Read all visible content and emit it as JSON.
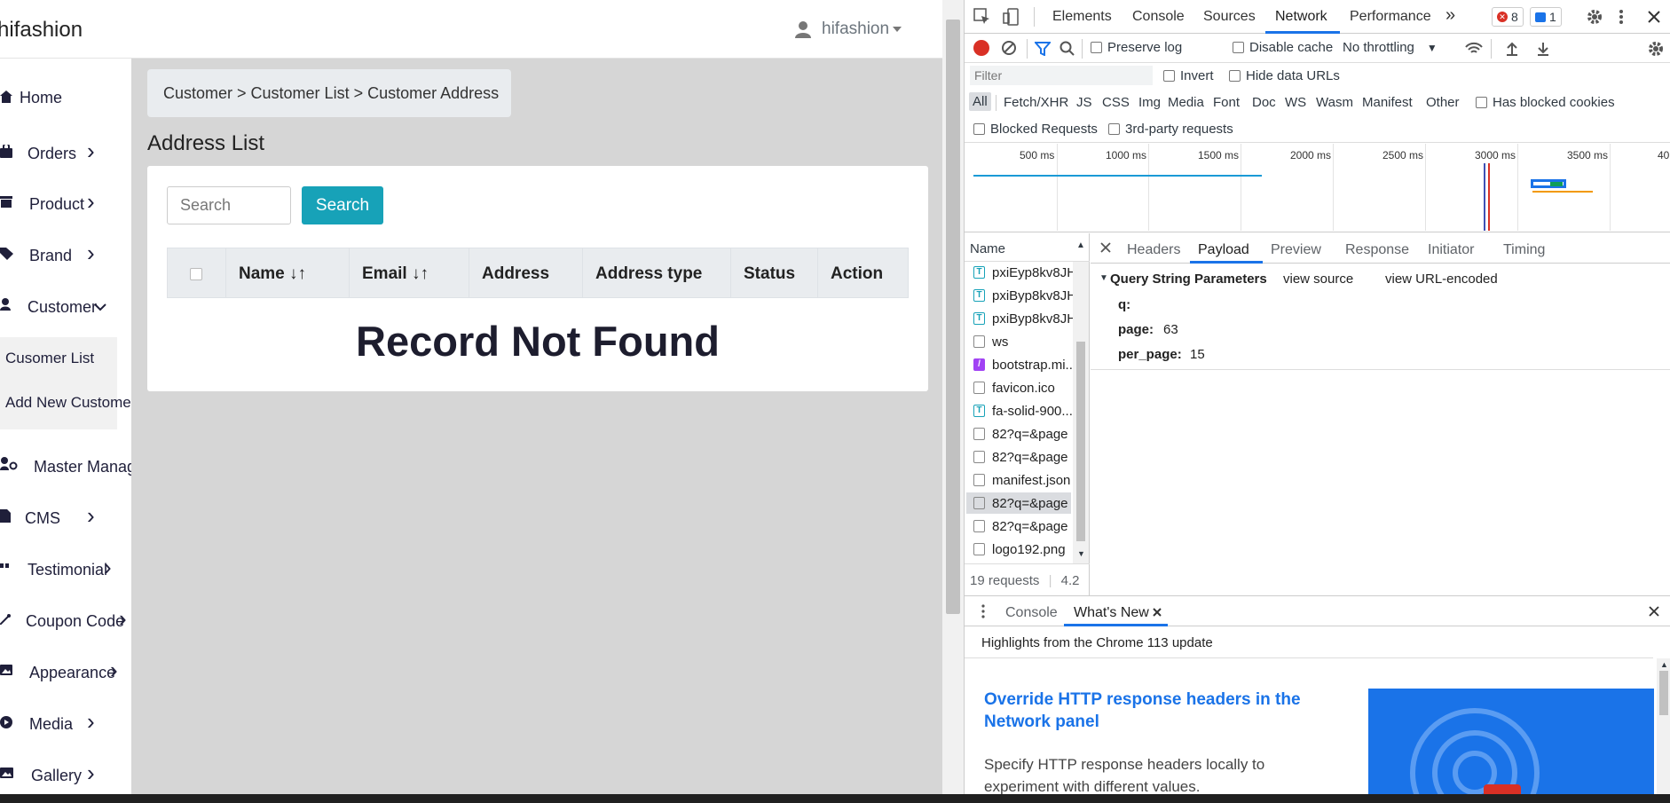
{
  "app": {
    "brand": "hifashion",
    "user": "hifashion"
  },
  "sidebar": {
    "items": [
      {
        "label": "Home",
        "chevron": ""
      },
      {
        "label": "Orders",
        "chevron": "›"
      },
      {
        "label": "Product",
        "chevron": "›"
      },
      {
        "label": "Brand",
        "chevron": "›"
      },
      {
        "label": "Customer",
        "chevron": "⌄"
      },
      {
        "label": "Master Manage",
        "chevron": ""
      },
      {
        "label": "CMS",
        "chevron": "›"
      },
      {
        "label": "Testimonial",
        "chevron": "›"
      },
      {
        "label": "Coupon Code",
        "chevron": "›"
      },
      {
        "label": "Appearance",
        "chevron": "›"
      },
      {
        "label": "Media",
        "chevron": "›"
      },
      {
        "label": "Gallery",
        "chevron": "›"
      }
    ],
    "customer_sub": [
      "Cusomer List",
      "Add New Customer"
    ]
  },
  "content": {
    "breadcrumb": "Customer > Customer List > Customer Address",
    "title": "Address List",
    "search_placeholder": "Search",
    "search_button": "Search",
    "columns": [
      "",
      "Name ↓↑",
      "Email ↓↑",
      "Address",
      "Address type",
      "Status",
      "Action"
    ],
    "empty_message": "Record Not Found"
  },
  "devtools": {
    "tabs": [
      "Elements",
      "Console",
      "Sources",
      "Network",
      "Performance",
      "»"
    ],
    "active_tab": "Network",
    "error_count": "8",
    "message_count": "1",
    "toolbar": {
      "preserve_log": "Preserve log",
      "disable_cache": "Disable cache",
      "throttling": "No throttling"
    },
    "filter": {
      "placeholder": "Filter",
      "invert": "Invert",
      "hide_data_urls": "Hide data URLs",
      "types": [
        "All",
        "Fetch/XHR",
        "JS",
        "CSS",
        "Img",
        "Media",
        "Font",
        "Doc",
        "WS",
        "Wasm",
        "Manifest",
        "Other"
      ],
      "has_blocked_cookies": "Has blocked cookies",
      "blocked_requests": "Blocked Requests",
      "third_party": "3rd-party requests"
    },
    "timeline_ticks": [
      "500 ms",
      "1000 ms",
      "1500 ms",
      "2000 ms",
      "2500 ms",
      "3000 ms",
      "3500 ms",
      "40"
    ],
    "requests": {
      "header": "Name",
      "items": [
        {
          "name": "pxiEyp8kv8JH",
          "icon": "T"
        },
        {
          "name": "pxiByp8kv8JH",
          "icon": "T"
        },
        {
          "name": "pxiByp8kv8JH",
          "icon": "T"
        },
        {
          "name": "ws",
          "icon": ""
        },
        {
          "name": "bootstrap.mi...",
          "icon": "/"
        },
        {
          "name": "favicon.ico",
          "icon": ""
        },
        {
          "name": "fa-solid-900...",
          "icon": "T"
        },
        {
          "name": "82?q=&page",
          "icon": ""
        },
        {
          "name": "82?q=&page",
          "icon": ""
        },
        {
          "name": "manifest.json",
          "icon": ""
        },
        {
          "name": "82?q=&page",
          "icon": ""
        },
        {
          "name": "82?q=&page",
          "icon": ""
        },
        {
          "name": "logo192.png",
          "icon": ""
        }
      ],
      "summary": "19 requests",
      "transfer": "4.2"
    },
    "detail_tabs": [
      "Headers",
      "Payload",
      "Preview",
      "Response",
      "Initiator",
      "Timing"
    ],
    "active_detail_tab": "Payload",
    "payload": {
      "section": "Query String Parameters",
      "view_source": "view source",
      "view_url_encoded": "view URL-encoded",
      "params": [
        {
          "key": "q:",
          "value": ""
        },
        {
          "key": "page:",
          "value": "63"
        },
        {
          "key": "per_page:",
          "value": "15"
        }
      ]
    },
    "drawer": {
      "tabs": [
        "Console",
        "What's New"
      ],
      "highlights": "Highlights from the Chrome 113 update",
      "headline": "Override HTTP response headers in the Network panel",
      "body": "Specify HTTP response headers locally to experiment with different values."
    }
  },
  "colors": {
    "accent": "#17a2b8",
    "content_bg": "#d6d6d6",
    "devtools_blue": "#1a73e8",
    "record_red": "#d93025"
  }
}
